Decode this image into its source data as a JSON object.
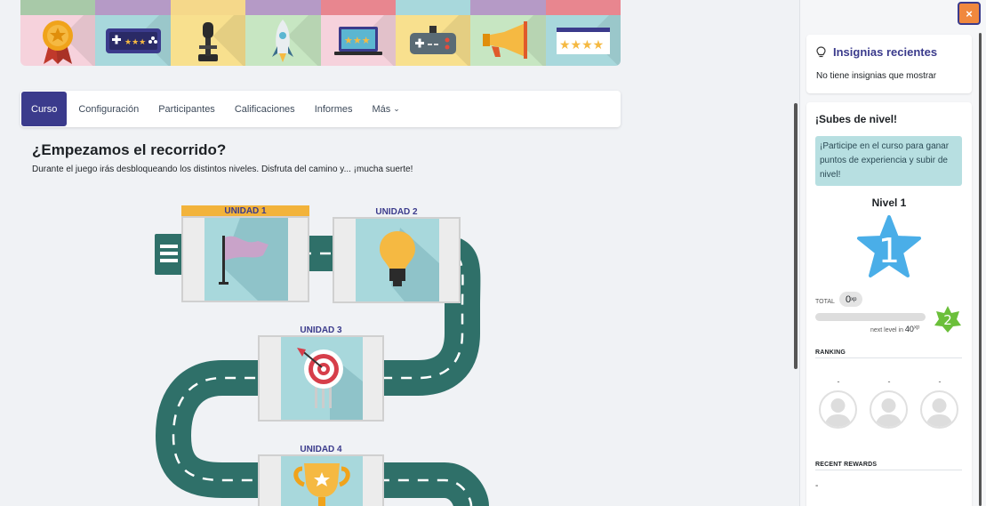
{
  "banner": {
    "strip_colors": [
      "#a8c9a8",
      "#b59ac6",
      "#f5d88a",
      "#b59ac6",
      "#e8868f",
      "#a8d8dc",
      "#b59ac6",
      "#e8868f"
    ],
    "tiles": [
      {
        "icon": "medal-icon",
        "bg": "#f6d2dc"
      },
      {
        "icon": "gamepad-stars-icon",
        "bg": "#a8d8dc"
      },
      {
        "icon": "joystick-icon",
        "bg": "#f8e08e"
      },
      {
        "icon": "rocket-icon",
        "bg": "#c7e6c2"
      },
      {
        "icon": "laptop-stars-icon",
        "bg": "#f6d2dc"
      },
      {
        "icon": "controller-icon",
        "bg": "#f8e08e"
      },
      {
        "icon": "megaphone-icon",
        "bg": "#c7e6c2"
      },
      {
        "icon": "browser-stars-icon",
        "bg": "#a8d8dc"
      }
    ]
  },
  "nav": {
    "tabs": [
      {
        "label": "Curso",
        "active": true
      },
      {
        "label": "Configuración",
        "active": false
      },
      {
        "label": "Participantes",
        "active": false
      },
      {
        "label": "Calificaciones",
        "active": false
      },
      {
        "label": "Informes",
        "active": false
      }
    ],
    "more_label": "Más"
  },
  "intro": {
    "title": "¿Empezamos el recorrido?",
    "text": "Durante el juego irás desbloqueando los distintos niveles. Disfruta del camino y... ¡mucha suerte!"
  },
  "units": [
    {
      "label": "UNIDAD 1",
      "icon": "flag-icon",
      "current": true
    },
    {
      "label": "UNIDAD 2",
      "icon": "lightbulb-icon",
      "current": false
    },
    {
      "label": "UNIDAD 3",
      "icon": "target-icon",
      "current": false
    },
    {
      "label": "UNIDAD 4",
      "icon": "trophy-icon",
      "current": false
    }
  ],
  "drawer": {
    "close_label": "×",
    "badges": {
      "title": "Insignias recientes",
      "message": "No tiene insignias que mostrar",
      "icon": "lightbulb-outline-icon"
    },
    "levelup": {
      "title": "¡Subes de nivel!",
      "info": "¡Participe en el curso para ganar puntos de experiencia y subir de nivel!",
      "level_name": "Nivel 1",
      "level_number": "1",
      "total_label": "TOTAL",
      "xp_value": "0",
      "xp_unit": "xp",
      "progress_fraction": 0,
      "next_level_text": "next level in",
      "next_level_xp": "40",
      "next_level_number": "2",
      "level_color": "#4aaee8",
      "next_level_color": "#6bbf3a"
    },
    "ranking": {
      "title": "RANKING",
      "entries": [
        {
          "name": "-"
        },
        {
          "name": "-"
        },
        {
          "name": "-"
        }
      ]
    },
    "rewards": {
      "title": "RECENT REWARDS",
      "text": "-"
    }
  }
}
